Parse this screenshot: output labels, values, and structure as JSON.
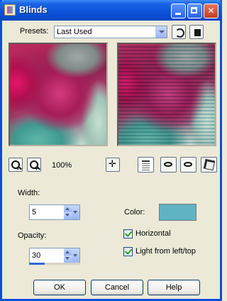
{
  "window": {
    "title": "Blinds"
  },
  "presets": {
    "label": "Presets:",
    "value": "Last Used"
  },
  "zoom": {
    "level": "100%"
  },
  "width": {
    "label": "Width:",
    "value": "5"
  },
  "opacity": {
    "label": "Opacity:",
    "value": "30",
    "fraction": 0.3
  },
  "color": {
    "label": "Color:",
    "swatch": "#5fb3c3"
  },
  "options": {
    "horizontal": {
      "label": "Horizontal",
      "checked": true
    },
    "light_from_left_top": {
      "label": "Light from left/top",
      "checked": true
    }
  },
  "buttons": {
    "ok": "OK",
    "cancel": "Cancel",
    "help": "Help"
  },
  "theme": {
    "title_bar": "#0a52d9",
    "dialog_bg": "#ece9d8"
  },
  "icons": {
    "title": "blinds-app-icon",
    "reset": "reset-icon",
    "save": "save-preset-icon",
    "zoom_out": "zoom-out-icon",
    "zoom_in": "zoom-in-icon",
    "move": "move-icon",
    "properties": "properties-icon",
    "randomize": "randomize-icon",
    "proof": "proof-icon",
    "dice": "dice-icon"
  }
}
